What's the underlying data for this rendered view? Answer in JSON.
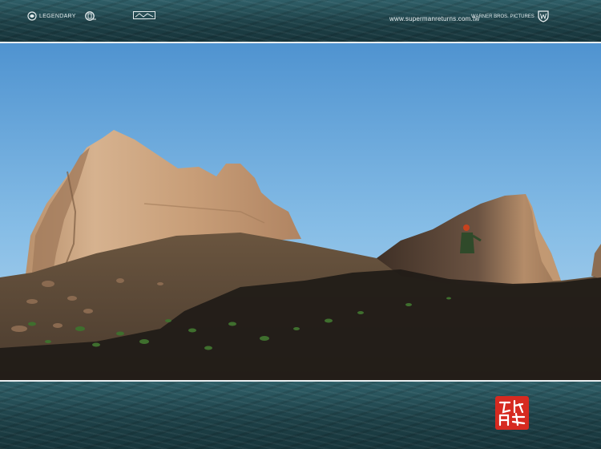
{
  "header": {
    "logos": [
      {
        "icon": "legendary-pictures-logo",
        "text": "LEGENDARY"
      },
      {
        "icon": "dc-comics-logo",
        "text": ""
      },
      {
        "icon": "studio-logo",
        "text": ""
      }
    ],
    "website": "www.supermanreturns.com.tw",
    "distributor": {
      "icon": "warner-bros-shield-icon",
      "line1": "WARNER BROS. PICTURES",
      "line2": ""
    }
  },
  "photo": {
    "subject": "desert-ruins",
    "sky_top": "#5f9fd6",
    "sky_bottom": "#a9d0ea",
    "rock_color": "#c7a27f",
    "ground_color": "#4a3a2e",
    "shadow_color": "#1d1a17",
    "grass_color": "#3d6f2d"
  },
  "footer": {
    "seal": {
      "icon": "red-seal-stamp",
      "color": "#d62a20"
    }
  }
}
